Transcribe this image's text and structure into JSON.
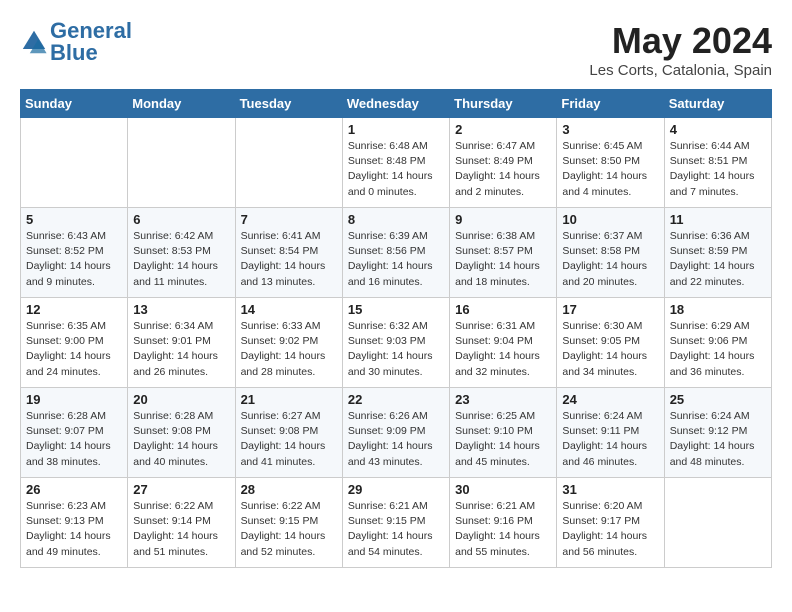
{
  "header": {
    "logo_general": "General",
    "logo_blue": "Blue",
    "month_title": "May 2024",
    "location": "Les Corts, Catalonia, Spain"
  },
  "days_of_week": [
    "Sunday",
    "Monday",
    "Tuesday",
    "Wednesday",
    "Thursday",
    "Friday",
    "Saturday"
  ],
  "weeks": [
    [
      {
        "day": "",
        "info": ""
      },
      {
        "day": "",
        "info": ""
      },
      {
        "day": "",
        "info": ""
      },
      {
        "day": "1",
        "info": "Sunrise: 6:48 AM\nSunset: 8:48 PM\nDaylight: 14 hours\nand 0 minutes."
      },
      {
        "day": "2",
        "info": "Sunrise: 6:47 AM\nSunset: 8:49 PM\nDaylight: 14 hours\nand 2 minutes."
      },
      {
        "day": "3",
        "info": "Sunrise: 6:45 AM\nSunset: 8:50 PM\nDaylight: 14 hours\nand 4 minutes."
      },
      {
        "day": "4",
        "info": "Sunrise: 6:44 AM\nSunset: 8:51 PM\nDaylight: 14 hours\nand 7 minutes."
      }
    ],
    [
      {
        "day": "5",
        "info": "Sunrise: 6:43 AM\nSunset: 8:52 PM\nDaylight: 14 hours\nand 9 minutes."
      },
      {
        "day": "6",
        "info": "Sunrise: 6:42 AM\nSunset: 8:53 PM\nDaylight: 14 hours\nand 11 minutes."
      },
      {
        "day": "7",
        "info": "Sunrise: 6:41 AM\nSunset: 8:54 PM\nDaylight: 14 hours\nand 13 minutes."
      },
      {
        "day": "8",
        "info": "Sunrise: 6:39 AM\nSunset: 8:56 PM\nDaylight: 14 hours\nand 16 minutes."
      },
      {
        "day": "9",
        "info": "Sunrise: 6:38 AM\nSunset: 8:57 PM\nDaylight: 14 hours\nand 18 minutes."
      },
      {
        "day": "10",
        "info": "Sunrise: 6:37 AM\nSunset: 8:58 PM\nDaylight: 14 hours\nand 20 minutes."
      },
      {
        "day": "11",
        "info": "Sunrise: 6:36 AM\nSunset: 8:59 PM\nDaylight: 14 hours\nand 22 minutes."
      }
    ],
    [
      {
        "day": "12",
        "info": "Sunrise: 6:35 AM\nSunset: 9:00 PM\nDaylight: 14 hours\nand 24 minutes."
      },
      {
        "day": "13",
        "info": "Sunrise: 6:34 AM\nSunset: 9:01 PM\nDaylight: 14 hours\nand 26 minutes."
      },
      {
        "day": "14",
        "info": "Sunrise: 6:33 AM\nSunset: 9:02 PM\nDaylight: 14 hours\nand 28 minutes."
      },
      {
        "day": "15",
        "info": "Sunrise: 6:32 AM\nSunset: 9:03 PM\nDaylight: 14 hours\nand 30 minutes."
      },
      {
        "day": "16",
        "info": "Sunrise: 6:31 AM\nSunset: 9:04 PM\nDaylight: 14 hours\nand 32 minutes."
      },
      {
        "day": "17",
        "info": "Sunrise: 6:30 AM\nSunset: 9:05 PM\nDaylight: 14 hours\nand 34 minutes."
      },
      {
        "day": "18",
        "info": "Sunrise: 6:29 AM\nSunset: 9:06 PM\nDaylight: 14 hours\nand 36 minutes."
      }
    ],
    [
      {
        "day": "19",
        "info": "Sunrise: 6:28 AM\nSunset: 9:07 PM\nDaylight: 14 hours\nand 38 minutes."
      },
      {
        "day": "20",
        "info": "Sunrise: 6:28 AM\nSunset: 9:08 PM\nDaylight: 14 hours\nand 40 minutes."
      },
      {
        "day": "21",
        "info": "Sunrise: 6:27 AM\nSunset: 9:08 PM\nDaylight: 14 hours\nand 41 minutes."
      },
      {
        "day": "22",
        "info": "Sunrise: 6:26 AM\nSunset: 9:09 PM\nDaylight: 14 hours\nand 43 minutes."
      },
      {
        "day": "23",
        "info": "Sunrise: 6:25 AM\nSunset: 9:10 PM\nDaylight: 14 hours\nand 45 minutes."
      },
      {
        "day": "24",
        "info": "Sunrise: 6:24 AM\nSunset: 9:11 PM\nDaylight: 14 hours\nand 46 minutes."
      },
      {
        "day": "25",
        "info": "Sunrise: 6:24 AM\nSunset: 9:12 PM\nDaylight: 14 hours\nand 48 minutes."
      }
    ],
    [
      {
        "day": "26",
        "info": "Sunrise: 6:23 AM\nSunset: 9:13 PM\nDaylight: 14 hours\nand 49 minutes."
      },
      {
        "day": "27",
        "info": "Sunrise: 6:22 AM\nSunset: 9:14 PM\nDaylight: 14 hours\nand 51 minutes."
      },
      {
        "day": "28",
        "info": "Sunrise: 6:22 AM\nSunset: 9:15 PM\nDaylight: 14 hours\nand 52 minutes."
      },
      {
        "day": "29",
        "info": "Sunrise: 6:21 AM\nSunset: 9:15 PM\nDaylight: 14 hours\nand 54 minutes."
      },
      {
        "day": "30",
        "info": "Sunrise: 6:21 AM\nSunset: 9:16 PM\nDaylight: 14 hours\nand 55 minutes."
      },
      {
        "day": "31",
        "info": "Sunrise: 6:20 AM\nSunset: 9:17 PM\nDaylight: 14 hours\nand 56 minutes."
      },
      {
        "day": "",
        "info": ""
      }
    ]
  ]
}
